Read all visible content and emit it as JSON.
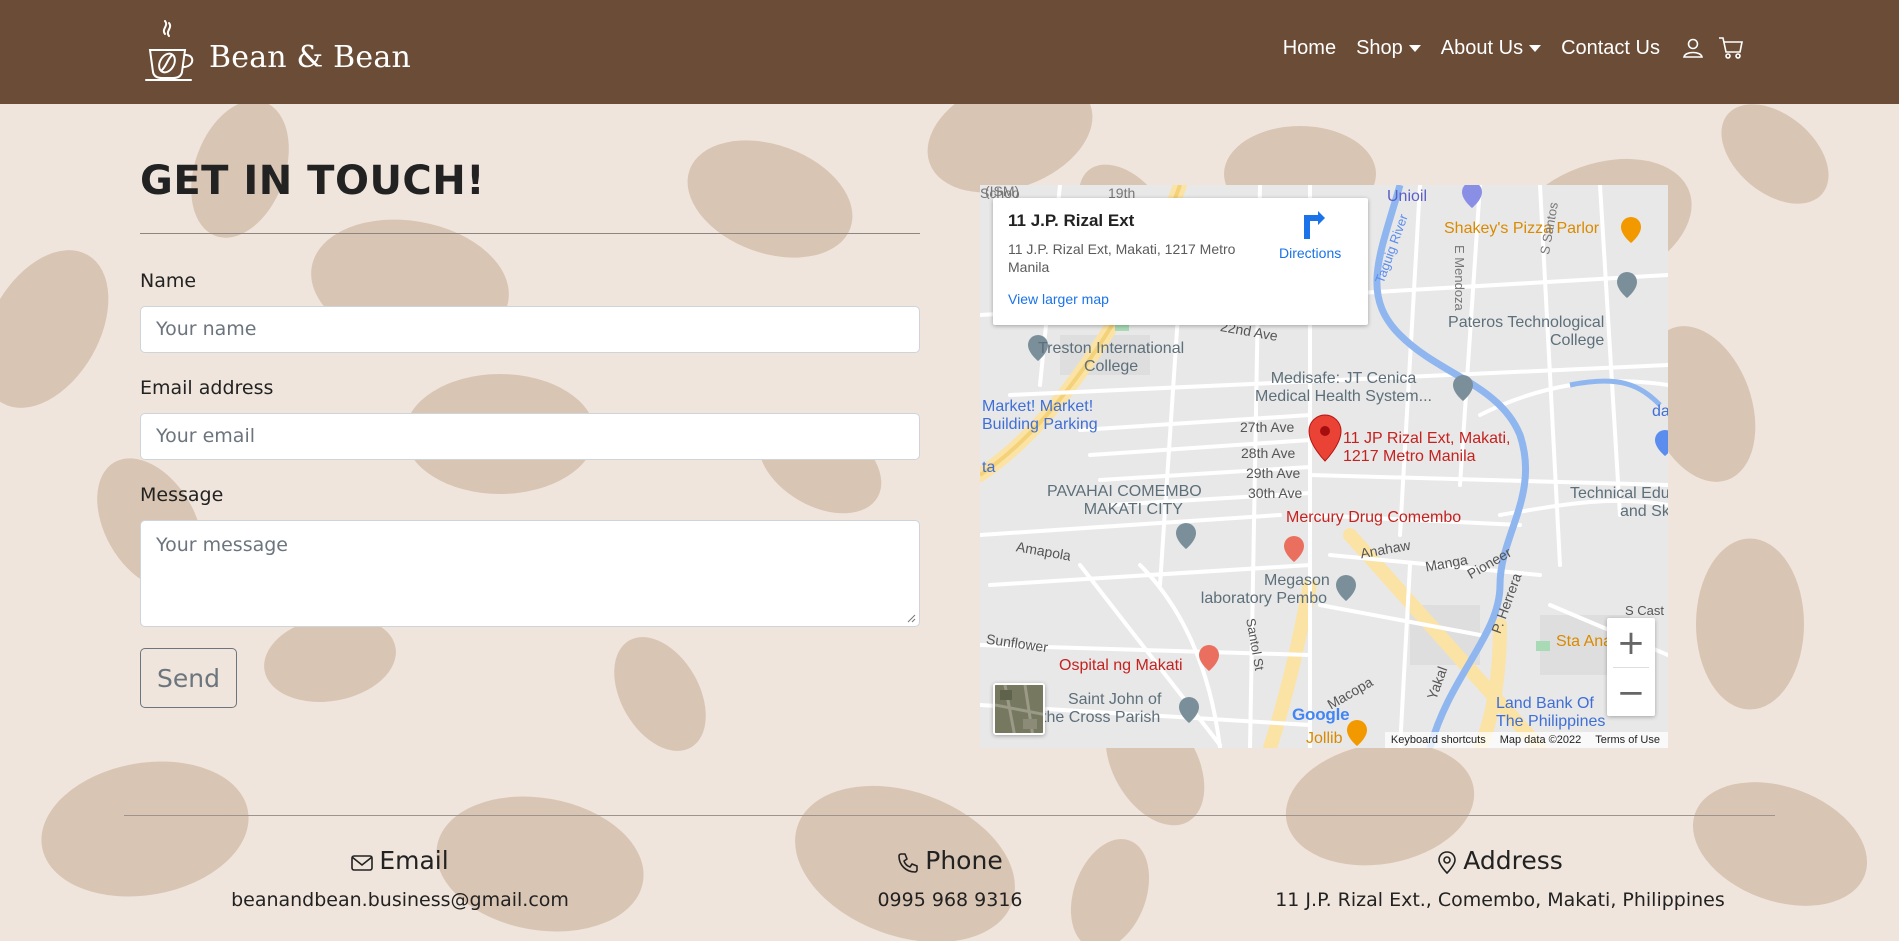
{
  "brand": {
    "name": "Bean & Bean",
    "logo_icon": "coffee-cup-logo-icon"
  },
  "nav": {
    "items": [
      {
        "label": "Home",
        "dropdown": false
      },
      {
        "label": "Shop",
        "dropdown": true
      },
      {
        "label": "About Us",
        "dropdown": true
      },
      {
        "label": "Contact Us",
        "dropdown": false
      }
    ],
    "icons": [
      "user-icon",
      "cart-icon"
    ]
  },
  "form": {
    "heading": "GET IN TOUCH!",
    "name_label": "Name",
    "name_placeholder": "Your name",
    "name_value": "",
    "email_label": "Email address",
    "email_placeholder": "Your email",
    "email_value": "",
    "message_label": "Message",
    "message_placeholder": "Your message",
    "message_value": "",
    "send_label": "Send"
  },
  "map": {
    "card_title": "11 J.P. Rizal Ext",
    "card_address": "11 J.P. Rizal Ext, Makati, 1217 Metro Manila",
    "larger_map": "View larger map",
    "directions": "Directions",
    "pin_label_1": "11 JP Rizal Ext, Makati,",
    "pin_label_2": "1217 Metro Manila",
    "labels": {
      "unioil": "Unioil",
      "shakeys": "Shakey's Pizza Parlor",
      "pateros_1": "Pateros Technological",
      "pateros_2": "College",
      "treston_1": "Treston International",
      "treston_2": "College",
      "market_1": "Market! Market!",
      "market_2": "Building Parking",
      "medisafe_1": "Medisafe: JT Cenica",
      "medisafe_2": "Medical Health System...",
      "pavahai_1": "PAVAHAI COMEMBO",
      "pavahai_2": "MAKATI CITY",
      "mercury": "Mercury Drug Comembo",
      "megason_1": "Megason",
      "megason_2": "laboratory Pembo",
      "ospital": "Ospital ng Makati",
      "saint_1": "Saint John of",
      "saint_2": "the Cross Parish",
      "techedu_1": "Technical Educa",
      "techedu_2": "and Sk",
      "landbank_1": "Land Bank Of",
      "landbank_2": "The Philippines",
      "sta_ana": "Sta Ana Cava",
      "ave27": "27th Ave",
      "ave28": "28th Ave",
      "ave29": "29th Ave",
      "ave30": "30th Ave",
      "ave22": "22nd Ave",
      "amapola": "Amapola",
      "anahaw": "Anahaw",
      "manga": "Manga",
      "pioneer": "Pioneer",
      "santol": "Santol St",
      "macopa": "Macopa",
      "yakal": "Yakal",
      "pherrera": "P. Herrera",
      "sunflower": "Sunflower",
      "taguig": "Taguig River",
      "emendoza": "E Mendoza",
      "ssantos": "S Santos",
      "scast": "S Cast",
      "jollib": "Jollib",
      "ism": "(ISM)",
      "th19": "19th",
      "ta": "ta",
      "da": "da",
      "schoo": "Schoo"
    },
    "google": "Google",
    "attribution": [
      "Keyboard shortcuts",
      "Map data ©2022",
      "Terms of Use"
    ],
    "zoom_in": "+",
    "zoom_out": "−"
  },
  "footer": {
    "email_title": "Email",
    "email_value": "beanandbean.business@gmail.com",
    "phone_title": "Phone",
    "phone_value": "0995 968 9316",
    "address_title": "Address",
    "address_value": "11 J.P. Rizal Ext., Comembo, Makati, Philippines"
  },
  "colors": {
    "navbar": "#6b4c36",
    "page_bg": "#efe5dc",
    "bean": "#d9c5b3",
    "map_link": "#1a73e8",
    "pin_red": "#ea4335"
  }
}
